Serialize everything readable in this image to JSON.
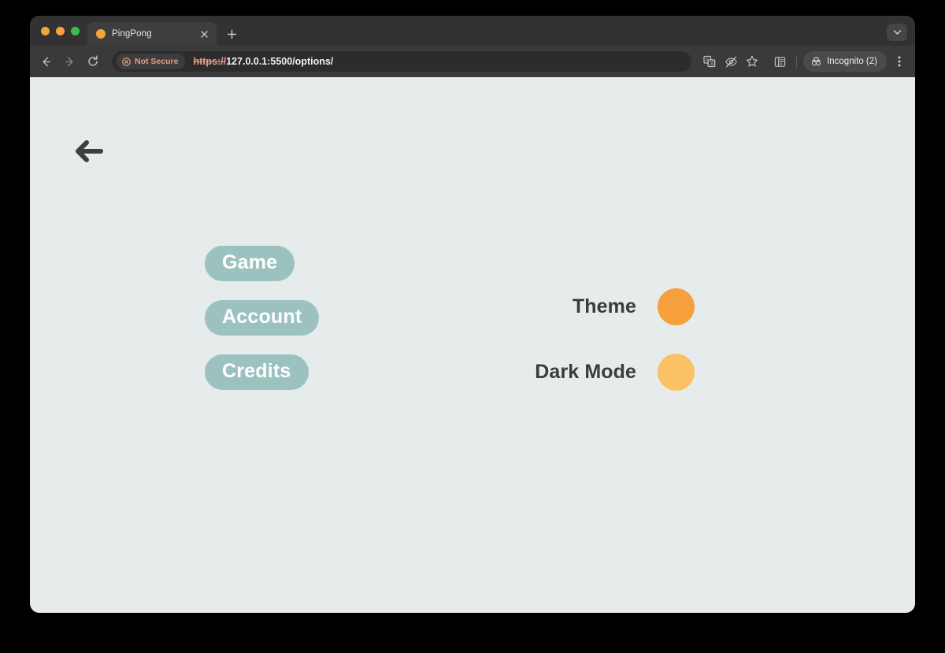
{
  "window": {
    "traffic_lights": [
      {
        "name": "close",
        "color": "#F5A33C"
      },
      {
        "name": "minimize",
        "color": "#F5A33C"
      },
      {
        "name": "zoom",
        "color": "#3BBF4B"
      }
    ]
  },
  "tabs": {
    "items": [
      {
        "title": "PingPong",
        "favicon_color": "#F5A33C",
        "active": true
      }
    ],
    "new_tab_icon": "plus-icon",
    "close_icon": "close-icon",
    "tab_search_icon": "chevron-down-icon"
  },
  "toolbar": {
    "back_icon": "back-arrow-icon",
    "forward_icon": "forward-arrow-icon",
    "reload_icon": "reload-icon",
    "security": {
      "icon": "not-secure-icon",
      "label": "Not Secure",
      "color": "#E99B86"
    },
    "url": {
      "scheme": "https://",
      "rest": "127.0.0.1:5500/options/"
    },
    "right_icons": [
      {
        "name": "translate-icon"
      },
      {
        "name": "eye-slash-icon"
      },
      {
        "name": "star-icon"
      },
      {
        "name": "side-panel-icon"
      }
    ],
    "incognito": {
      "icon": "incognito-mask-icon",
      "label": "Incognito (2)"
    },
    "menu_icon": "three-dot-menu-icon"
  },
  "page": {
    "background": "#E6EBEC",
    "back_button": {
      "icon": "arrow-left-icon",
      "color": "#3F3F3F"
    },
    "menu_buttons": [
      {
        "label": "Game",
        "color": "#9CC2C0",
        "text_color": "#FFFFFF"
      },
      {
        "label": "Account",
        "color": "#9CC2C0",
        "text_color": "#FFFFFF"
      },
      {
        "label": "Credits",
        "color": "#9CC2C0",
        "text_color": "#FFFFFF"
      }
    ],
    "settings": [
      {
        "label": "Theme",
        "swatch_color": "#F5A03C",
        "swatch_name": "theme-color-swatch"
      },
      {
        "label": "Dark Mode",
        "swatch_color": "#FBC164",
        "swatch_name": "dark-mode-toggle-swatch"
      }
    ]
  }
}
